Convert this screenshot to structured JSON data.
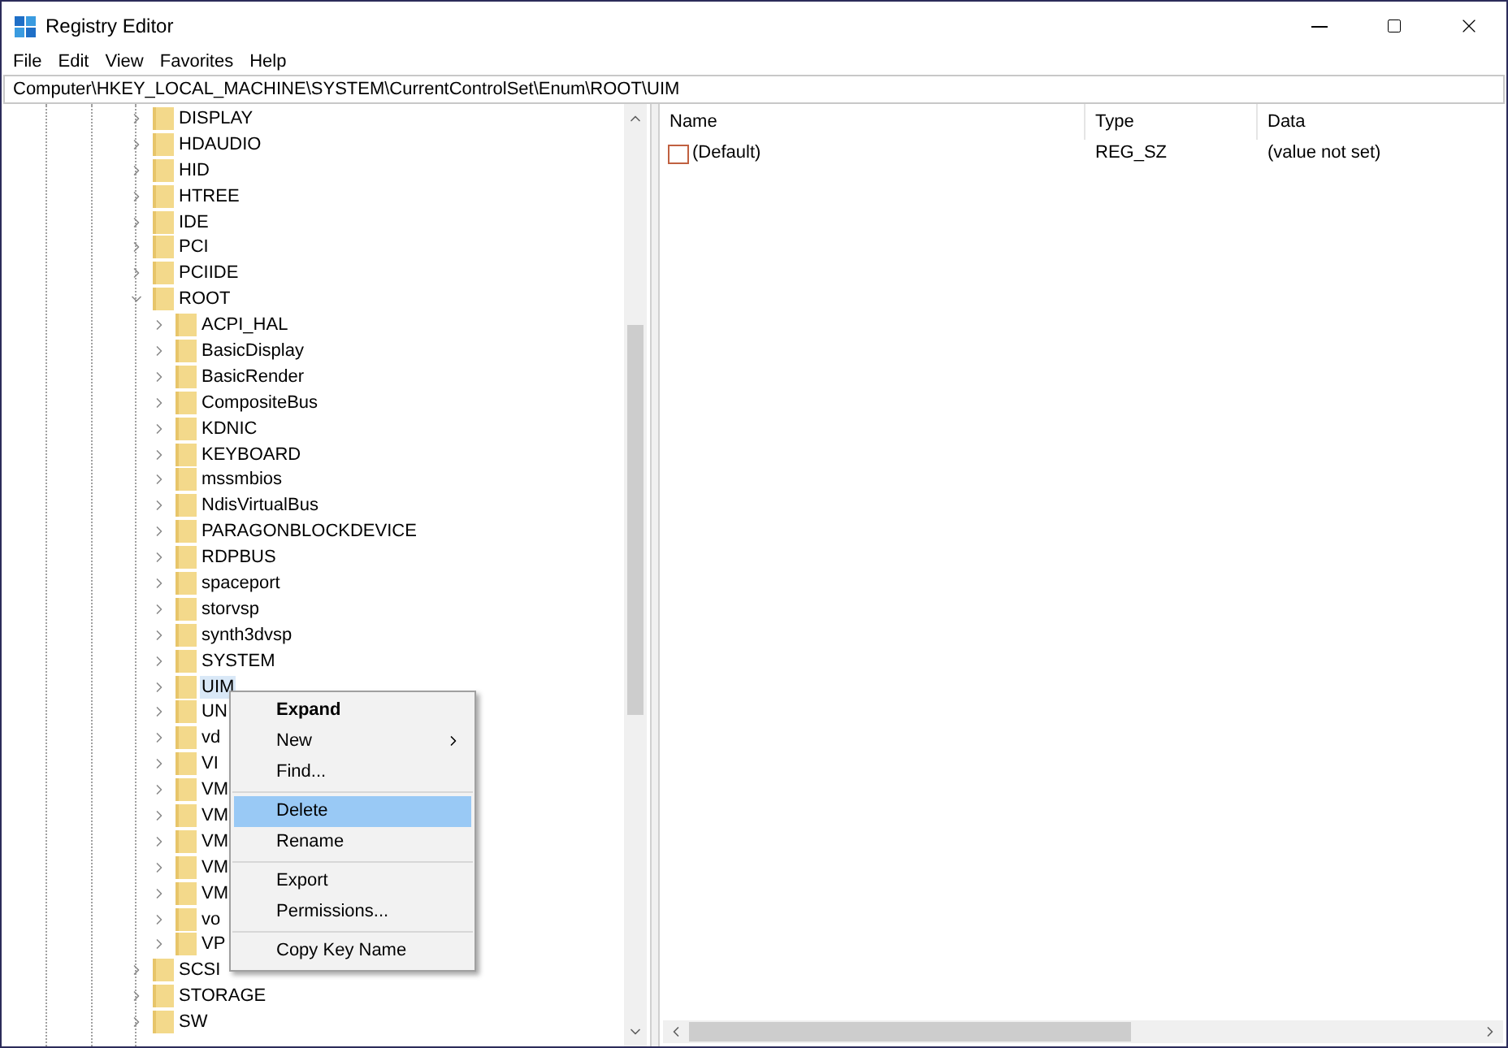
{
  "window": {
    "title": "Registry Editor"
  },
  "menu_bar": [
    "File",
    "Edit",
    "View",
    "Favorites",
    "Help"
  ],
  "address": "Computer\\HKEY_LOCAL_MACHINE\\SYSTEM\\CurrentControlSet\\Enum\\ROOT\\UIM",
  "tree": [
    {
      "label": "DISPLAY",
      "expanded": false,
      "selected": false
    },
    {
      "label": "HDAUDIO",
      "expanded": false,
      "selected": false
    },
    {
      "label": "HID",
      "expanded": false,
      "selected": false
    },
    {
      "label": "HTREE",
      "expanded": false,
      "selected": false
    },
    {
      "label": "IDE",
      "expanded": false,
      "selected": false
    },
    {
      "label": "PCI",
      "expanded": false,
      "selected": false
    },
    {
      "label": "PCIIDE",
      "expanded": false,
      "selected": false
    },
    {
      "label": "ROOT",
      "expanded": true,
      "selected": false,
      "children": [
        {
          "label": "ACPI_HAL",
          "expanded": false,
          "selected": false
        },
        {
          "label": "BasicDisplay",
          "expanded": false,
          "selected": false
        },
        {
          "label": "BasicRender",
          "expanded": false,
          "selected": false
        },
        {
          "label": "CompositeBus",
          "expanded": false,
          "selected": false
        },
        {
          "label": "KDNIC",
          "expanded": false,
          "selected": false
        },
        {
          "label": "KEYBOARD",
          "expanded": false,
          "selected": false
        },
        {
          "label": "mssmbios",
          "expanded": false,
          "selected": false
        },
        {
          "label": "NdisVirtualBus",
          "expanded": false,
          "selected": false
        },
        {
          "label": "PARAGONBLOCKDEVICE",
          "expanded": false,
          "selected": false
        },
        {
          "label": "RDPBUS",
          "expanded": false,
          "selected": false
        },
        {
          "label": "spaceport",
          "expanded": false,
          "selected": false
        },
        {
          "label": "storvsp",
          "expanded": false,
          "selected": false
        },
        {
          "label": "synth3dvsp",
          "expanded": false,
          "selected": false
        },
        {
          "label": "SYSTEM",
          "expanded": false,
          "selected": false
        },
        {
          "label": "UIM",
          "expanded": false,
          "selected": true
        },
        {
          "label": "UN",
          "expanded": false,
          "selected": false
        },
        {
          "label": "vd",
          "expanded": false,
          "selected": false
        },
        {
          "label": "VI",
          "expanded": false,
          "selected": false
        },
        {
          "label": "VM",
          "expanded": false,
          "selected": false
        },
        {
          "label": "VM",
          "expanded": false,
          "selected": false
        },
        {
          "label": "VM",
          "expanded": false,
          "selected": false
        },
        {
          "label": "VM",
          "expanded": false,
          "selected": false
        },
        {
          "label": "VM",
          "expanded": false,
          "selected": false
        },
        {
          "label": "vo",
          "expanded": false,
          "selected": false
        },
        {
          "label": "VP",
          "expanded": false,
          "selected": false
        }
      ]
    },
    {
      "label": "SCSI",
      "expanded": false,
      "selected": false
    },
    {
      "label": "STORAGE",
      "expanded": false,
      "selected": false
    },
    {
      "label": "SW",
      "expanded": false,
      "selected": false
    }
  ],
  "values_table": {
    "columns": [
      "Name",
      "Type",
      "Data"
    ],
    "rows": [
      {
        "name": "(Default)",
        "type": "REG_SZ",
        "data": "(value not set)"
      }
    ]
  },
  "context_menu": [
    {
      "kind": "item",
      "label": "Expand",
      "default": true,
      "submenu": false,
      "selected": false
    },
    {
      "kind": "item",
      "label": "New",
      "default": false,
      "submenu": true,
      "selected": false
    },
    {
      "kind": "item",
      "label": "Find...",
      "default": false,
      "submenu": false,
      "selected": false
    },
    {
      "kind": "separator"
    },
    {
      "kind": "item",
      "label": "Delete",
      "default": false,
      "submenu": false,
      "selected": true
    },
    {
      "kind": "item",
      "label": "Rename",
      "default": false,
      "submenu": false,
      "selected": false
    },
    {
      "kind": "separator"
    },
    {
      "kind": "item",
      "label": "Export",
      "default": false,
      "submenu": false,
      "selected": false
    },
    {
      "kind": "item",
      "label": "Permissions...",
      "default": false,
      "submenu": false,
      "selected": false
    },
    {
      "kind": "separator"
    },
    {
      "kind": "item",
      "label": "Copy Key Name",
      "default": false,
      "submenu": false,
      "selected": false
    }
  ]
}
